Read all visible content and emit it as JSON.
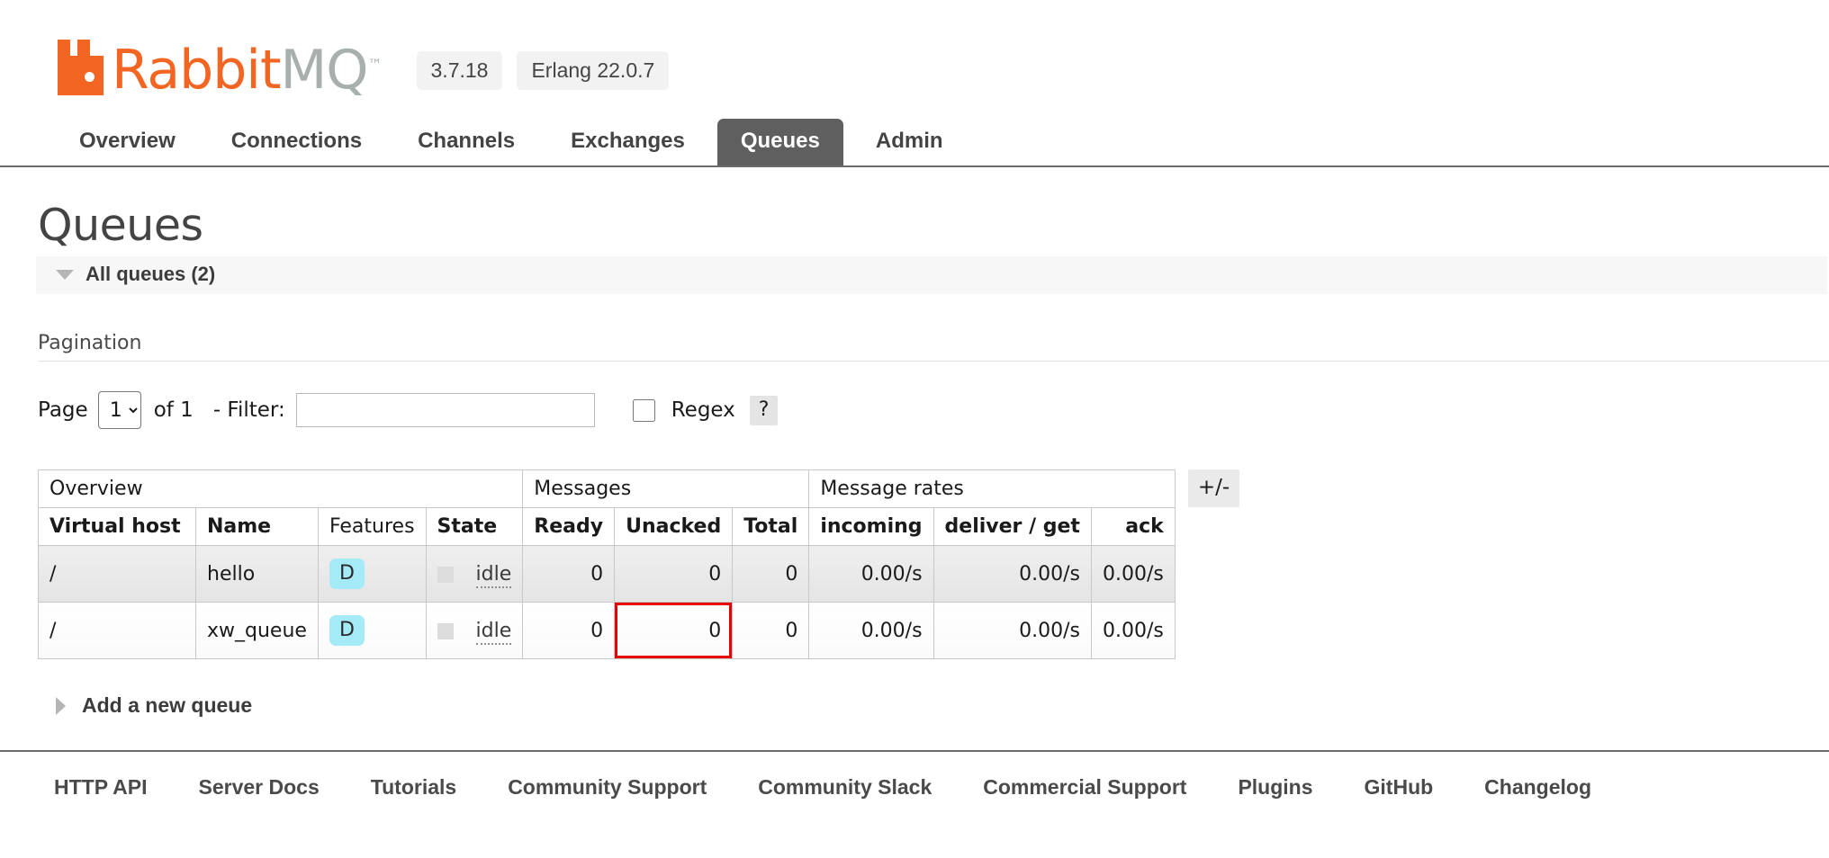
{
  "header": {
    "logo_text_primary": "Rabbit",
    "logo_text_secondary": "MQ",
    "logo_tm": "™",
    "version": "3.7.18",
    "erlang_version": "Erlang 22.0.7"
  },
  "nav": {
    "tabs": [
      {
        "label": "Overview",
        "active": false
      },
      {
        "label": "Connections",
        "active": false
      },
      {
        "label": "Channels",
        "active": false
      },
      {
        "label": "Exchanges",
        "active": false
      },
      {
        "label": "Queues",
        "active": true
      },
      {
        "label": "Admin",
        "active": false
      }
    ]
  },
  "page": {
    "title": "Queues",
    "all_queues_label": "All queues (2)",
    "pagination_label": "Pagination",
    "add_queue_label": "Add a new queue"
  },
  "pagination": {
    "page_label": "Page",
    "page_value": "1",
    "page_options": [
      "1"
    ],
    "of_label": "of 1",
    "filter_label": "- Filter:",
    "filter_value": "",
    "filter_placeholder": "",
    "regex_label": "Regex",
    "regex_checked": false,
    "help_label": "?"
  },
  "table": {
    "group_headers": [
      {
        "label": "Overview",
        "span": 4
      },
      {
        "label": "Messages",
        "span": 3
      },
      {
        "label": "Message rates",
        "span": 3
      }
    ],
    "columns": [
      {
        "label": "Virtual host",
        "bold": true,
        "align": "left"
      },
      {
        "label": "Name",
        "bold": true,
        "align": "left"
      },
      {
        "label": "Features",
        "bold": false,
        "align": "left"
      },
      {
        "label": "State",
        "bold": true,
        "align": "left"
      },
      {
        "label": "Ready",
        "bold": true,
        "align": "right"
      },
      {
        "label": "Unacked",
        "bold": true,
        "align": "right"
      },
      {
        "label": "Total",
        "bold": true,
        "align": "right"
      },
      {
        "label": "incoming",
        "bold": true,
        "align": "right"
      },
      {
        "label": "deliver / get",
        "bold": true,
        "align": "right"
      },
      {
        "label": "ack",
        "bold": true,
        "align": "right"
      }
    ],
    "toggle_columns_label": "+/-",
    "rows": [
      {
        "vhost": "/",
        "name": "hello",
        "features": "D",
        "state": "idle",
        "ready": "0",
        "unacked": "0",
        "total": "0",
        "incoming": "0.00/s",
        "deliver_get": "0.00/s",
        "ack": "0.00/s",
        "shaded": true,
        "highlight_unacked": false
      },
      {
        "vhost": "/",
        "name": "xw_queue",
        "features": "D",
        "state": "idle",
        "ready": "0",
        "unacked": "0",
        "total": "0",
        "incoming": "0.00/s",
        "deliver_get": "0.00/s",
        "ack": "0.00/s",
        "shaded": false,
        "highlight_unacked": true
      }
    ]
  },
  "footer": {
    "links": [
      "HTTP API",
      "Server Docs",
      "Tutorials",
      "Community Support",
      "Community Slack",
      "Commercial Support",
      "Plugins",
      "GitHub",
      "Changelog"
    ]
  },
  "colors": {
    "brand_orange": "#f26522",
    "brand_gray": "#a8b0ad",
    "active_tab_bg": "#5f5f5f",
    "feature_badge_bg": "#a5eaf7",
    "highlight_border": "#e60000"
  }
}
